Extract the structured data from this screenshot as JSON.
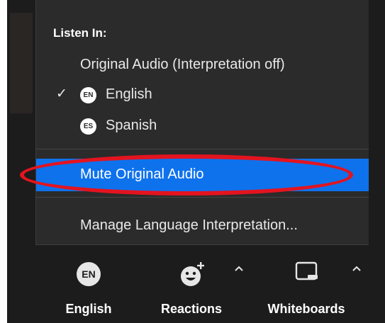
{
  "listen_menu": {
    "header": "Listen In:",
    "items": [
      {
        "label": "Original Audio (Interpretation off)",
        "badge": "",
        "checked": false
      },
      {
        "label": "English",
        "badge": "EN",
        "checked": true
      },
      {
        "label": "Spanish",
        "badge": "ES",
        "checked": false
      }
    ],
    "mute_item": {
      "label": "Mute Original Audio",
      "highlighted": true
    },
    "manage_item": {
      "label": "Manage Language Interpretation..."
    },
    "check_glyph": "✓"
  },
  "toolbar": {
    "language": {
      "badge": "EN",
      "label": "English"
    },
    "reactions": {
      "label": "Reactions"
    },
    "whiteboards": {
      "label": "Whiteboards"
    }
  },
  "colors": {
    "menu_bg": "#2b2b2b",
    "highlight": "#0e72ed",
    "annotation": "#e3141f",
    "toolbar_bg": "#1c1c1c"
  }
}
